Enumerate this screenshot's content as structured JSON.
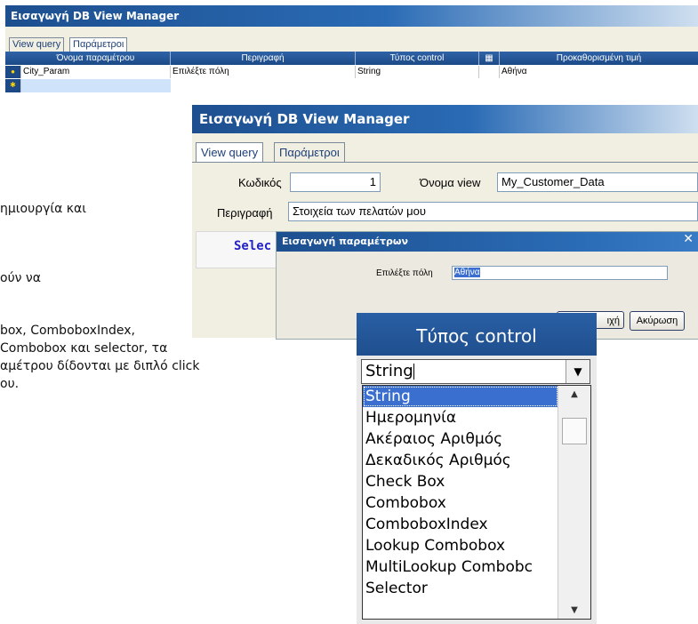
{
  "win1": {
    "title": "Εισαγωγή DB View Manager",
    "tabs": [
      "View query",
      "Παράμετροι"
    ],
    "columns": [
      "Όνομα παραμέτρου",
      "Περιγραφή",
      "Τύπος control",
      "Προκαθορισμένη τιμή"
    ],
    "row": {
      "name": "City_Param",
      "description": "Επιλέξτε πόλη",
      "type": "String",
      "default": "Αθήνα"
    }
  },
  "background_text": [
    "ημιουργία και",
    "ούν να",
    "box, ComboboxIndex,",
    "Combobox και selector, τα",
    "αμέτρου δίδονται με διπλό click",
    "ου."
  ],
  "win2": {
    "title": "Εισαγωγή DB View Manager",
    "tabs": [
      "View query",
      "Παράμετροι"
    ],
    "code_label": "Κωδικός",
    "code_value": "1",
    "view_name_label": "Όνομα view",
    "view_name_value": "My_Customer_Data",
    "description_label": "Περιγραφή",
    "description_value": "Στοιχεία των πελατών μου",
    "query_start": "Selec"
  },
  "dialog": {
    "title": "Εισαγωγή παραμέτρων",
    "field_label": "Επιλέξτε πόλη",
    "field_value": "Αθήνα",
    "ok_fragment": "ιχή",
    "cancel_label": "Ακύρωση"
  },
  "dropdown": {
    "header": "Τύπος control",
    "selected": "String",
    "options": [
      "String",
      "Ημερομηνία",
      "Ακέραιος Αριθμός",
      "Δεκαδικός Αριθμός",
      "Check Box",
      "Combobox",
      "ComboboxIndex",
      "Lookup Combobox",
      "MultiLookup Combobc",
      "Selector"
    ]
  }
}
